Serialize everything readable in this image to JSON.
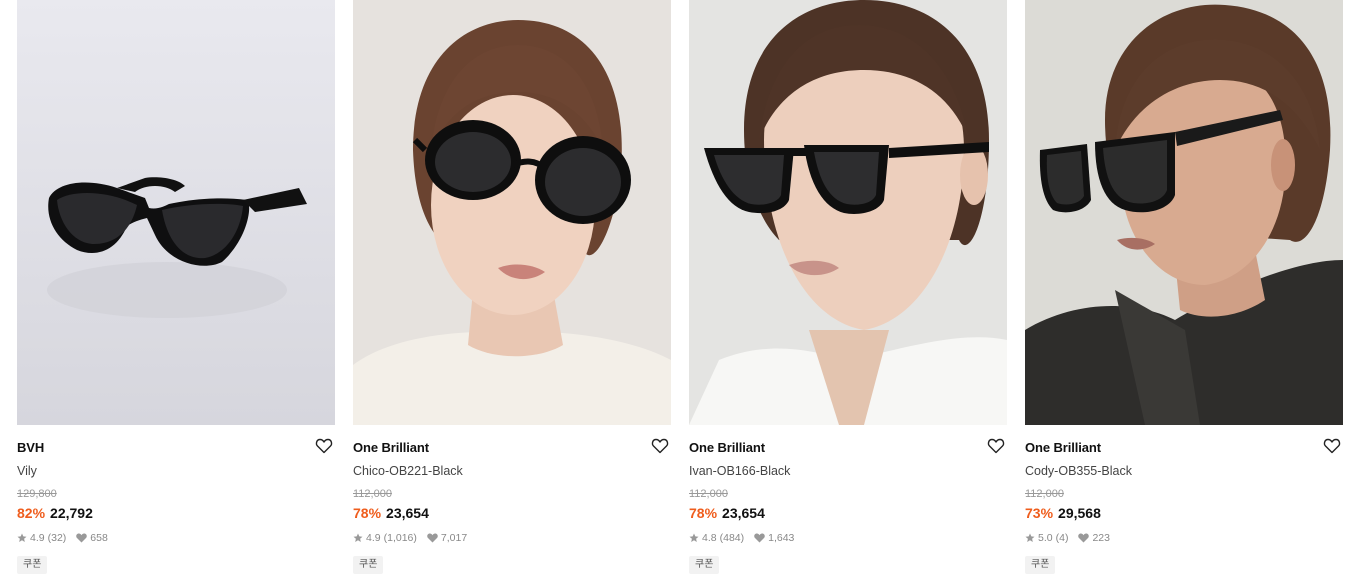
{
  "products": [
    {
      "brand": "BVH",
      "name": "Vily",
      "original_price": "129,800",
      "discount": "82%",
      "price": "22,792",
      "rating": "4.9",
      "reviews": "(32)",
      "likes": "658",
      "badge": "쿠폰"
    },
    {
      "brand": "One Brilliant",
      "name": "Chico-OB221-Black",
      "original_price": "112,000",
      "discount": "78%",
      "price": "23,654",
      "rating": "4.9",
      "reviews": "(1,016)",
      "likes": "7,017",
      "badge": "쿠폰"
    },
    {
      "brand": "One Brilliant",
      "name": "Ivan-OB166-Black",
      "original_price": "112,000",
      "discount": "78%",
      "price": "23,654",
      "rating": "4.8",
      "reviews": "(484)",
      "likes": "1,643",
      "badge": "쿠폰"
    },
    {
      "brand": "One Brilliant",
      "name": "Cody-OB355-Black",
      "original_price": "112,000",
      "discount": "73%",
      "price": "29,568",
      "rating": "5.0",
      "reviews": "(4)",
      "likes": "223",
      "badge": "쿠폰"
    }
  ],
  "icons": {
    "wishlist": "heart-outline-icon",
    "rating": "star-icon",
    "likes": "heart-filled-icon"
  },
  "colors": {
    "discount": "#ef5d1d",
    "muted": "#888888"
  }
}
